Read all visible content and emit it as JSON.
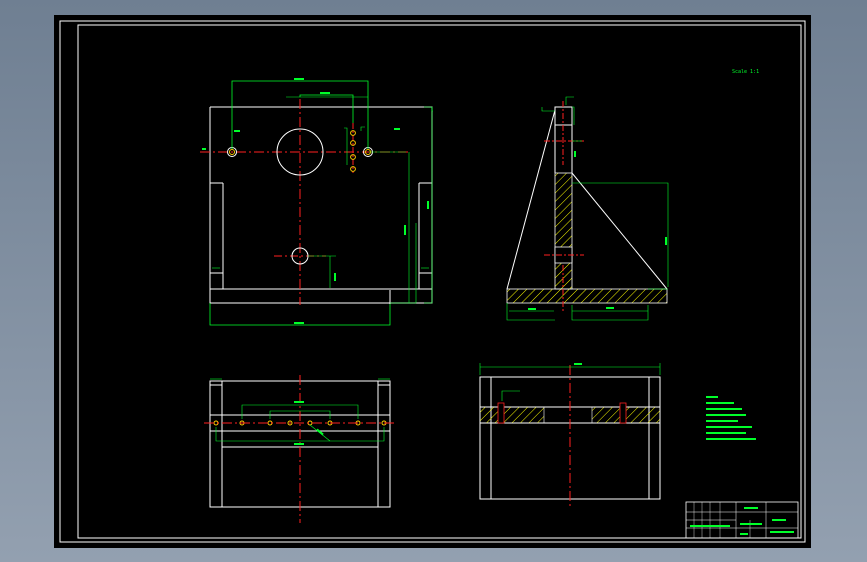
{
  "drawing": {
    "scale_note": "Scale 1:1",
    "title_block": {
      "drawing_title": "",
      "part_name": "",
      "drawing_number": ""
    }
  },
  "colors": {
    "background": "#000000",
    "outline": "#ffffff",
    "dimension": "#00ff2a",
    "centerline": "#ff2020",
    "hatch": "#ffff00",
    "hole": "#ffcc00",
    "window_bg": "#8595a6"
  }
}
